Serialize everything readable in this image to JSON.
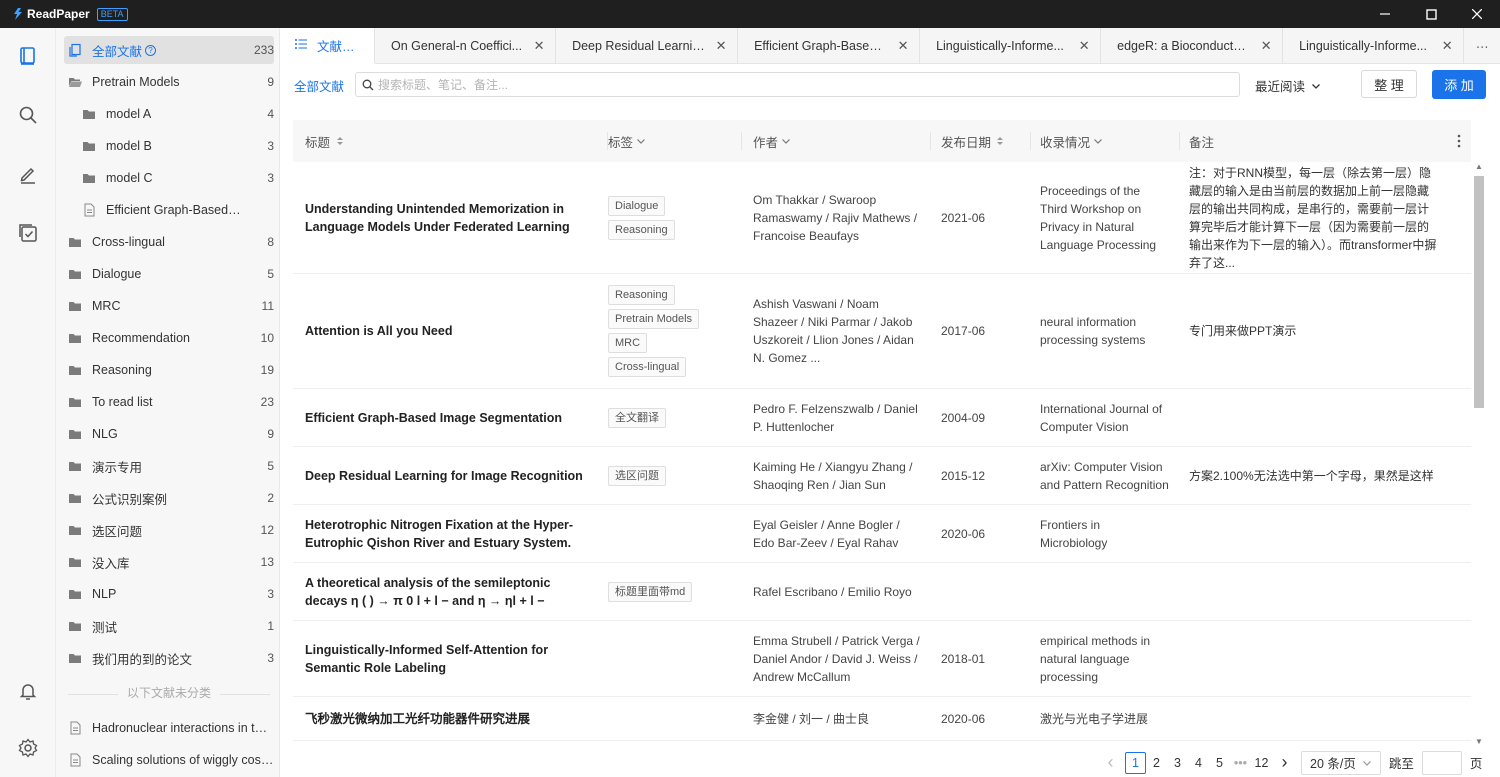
{
  "app": {
    "name": "ReadPaper",
    "badge": "BETA"
  },
  "sidebar": {
    "items": [
      {
        "label": "全部文献",
        "count": "233",
        "icon": "doc-stack-icon",
        "active": true
      },
      {
        "label": "Pretrain Models",
        "count": "9",
        "icon": "folder-open-icon"
      },
      {
        "label": "model A",
        "count": "4",
        "icon": "folder-icon"
      },
      {
        "label": "model B",
        "count": "3",
        "icon": "folder-icon"
      },
      {
        "label": "model C",
        "count": "3",
        "icon": "folder-icon"
      },
      {
        "label": "Efficient Graph-Based Image S...",
        "count": "",
        "icon": "file-icon"
      },
      {
        "label": "Cross-lingual",
        "count": "8",
        "icon": "folder-icon"
      },
      {
        "label": "Dialogue",
        "count": "5",
        "icon": "folder-icon"
      },
      {
        "label": "MRC",
        "count": "11",
        "icon": "folder-icon"
      },
      {
        "label": "Recommendation",
        "count": "10",
        "icon": "folder-icon"
      },
      {
        "label": "Reasoning",
        "count": "19",
        "icon": "folder-icon"
      },
      {
        "label": "To read list",
        "count": "23",
        "icon": "folder-icon"
      },
      {
        "label": "NLG",
        "count": "9",
        "icon": "folder-icon"
      },
      {
        "label": "演示专用",
        "count": "5",
        "icon": "folder-icon"
      },
      {
        "label": "公式识别案例",
        "count": "2",
        "icon": "folder-icon"
      },
      {
        "label": "选区问题",
        "count": "12",
        "icon": "folder-icon"
      },
      {
        "label": "没入库",
        "count": "13",
        "icon": "folder-icon"
      },
      {
        "label": "NLP",
        "count": "3",
        "icon": "folder-icon"
      },
      {
        "label": "测试",
        "count": "1",
        "icon": "folder-icon"
      },
      {
        "label": "我们用的到的论文",
        "count": "3",
        "icon": "folder-icon"
      }
    ],
    "unclassified_label": "以下文献未分类",
    "unclassified": [
      {
        "label": "Hadronuclear interactions in the j...",
        "icon": "file-icon"
      },
      {
        "label": "Scaling solutions of wiggly cosmi...",
        "icon": "file-icon"
      }
    ]
  },
  "tabs": [
    {
      "label": "文献列表",
      "active": true
    },
    {
      "label": "On General-n Coeffici..."
    },
    {
      "label": "Deep Residual Learnin..."
    },
    {
      "label": "Efficient Graph-Based I..."
    },
    {
      "label": "Linguistically-Informe..."
    },
    {
      "label": "edgeR: a Bioconductor..."
    },
    {
      "label": "Linguistically-Informe..."
    }
  ],
  "toolbar": {
    "all_label": "全部文献",
    "search_placeholder": "搜索标题、笔记、备注...",
    "sort_label": "最近阅读",
    "organize_label": "整 理",
    "add_label": "添 加"
  },
  "table": {
    "headers": {
      "title": "标题",
      "tags": "标签",
      "authors": "作者",
      "date": "发布日期",
      "venue": "收录情况",
      "notes": "备注"
    },
    "rows": [
      {
        "title": "Understanding Unintended Memorization in Language Models Under Federated Learning",
        "tags": [
          "Dialogue",
          "Reasoning"
        ],
        "authors": "Om Thakkar / Swaroop Ramaswamy / Rajiv Mathews / Francoise Beaufays",
        "date": "2021-06",
        "venue": "Proceedings of the Third Workshop on Privacy in Natural Language Processing",
        "note": "注：对于RNN模型，每一层（除去第一层）隐藏层的输入是由当前层的数据加上前一层隐藏层的输出共同构成，是串行的，需要前一层计算完毕后才能计算下一层（因为需要前一层的输出来作为下一层的输入）。而transformer中摒弃了这..."
      },
      {
        "title": "Attention is All you Need",
        "tags": [
          "Reasoning",
          "Pretrain Models",
          "MRC",
          "Cross-lingual"
        ],
        "authors": "Ashish Vaswani / Noam Shazeer / Niki Parmar / Jakob Uszkoreit / Llion Jones / Aidan N. Gomez ...",
        "date": "2017-06",
        "venue": "neural information processing systems",
        "note": "专门用来做PPT演示"
      },
      {
        "title": "Efficient Graph-Based Image Segmentation",
        "tags": [
          "全文翻译"
        ],
        "authors": "Pedro F. Felzenszwalb / Daniel P. Huttenlocher",
        "date": "2004-09",
        "venue": "International Journal of Computer Vision",
        "note": ""
      },
      {
        "title": "Deep Residual Learning for Image Recognition",
        "tags": [
          "选区问题"
        ],
        "authors": "Kaiming He / Xiangyu Zhang / Shaoqing Ren / Jian Sun",
        "date": "2015-12",
        "venue": "arXiv: Computer Vision and Pattern Recognition",
        "note": "方案2.100%无法选中第一个字母，果然是这样"
      },
      {
        "title": "Heterotrophic Nitrogen Fixation at the Hyper-Eutrophic Qishon River and Estuary System.",
        "tags": [],
        "authors": "Eyal Geisler / Anne Bogler / Edo Bar-Zeev / Eyal Rahav",
        "date": "2020-06",
        "venue": "Frontiers in Microbiology",
        "note": ""
      },
      {
        "title": "A theoretical analysis of the semileptonic decays η ( ) → π 0 l + l − and η → ηl + l −",
        "tags": [
          "标题里面带md"
        ],
        "authors": "Rafel Escribano / Emilio Royo",
        "date": "",
        "venue": "",
        "note": ""
      },
      {
        "title": "Linguistically-Informed Self-Attention for Semantic Role Labeling",
        "tags": [],
        "authors": "Emma Strubell / Patrick Verga / Daniel Andor / David J. Weiss / Andrew McCallum",
        "date": "2018-01",
        "venue": "empirical methods in natural language processing",
        "note": ""
      },
      {
        "title": "飞秒激光微纳加工光纤功能器件研究进展",
        "tags": [],
        "authors": "李金健 / 刘一 / 曲士良",
        "date": "2020-06",
        "venue": "激光与光电子学进展",
        "note": ""
      }
    ]
  },
  "pagination": {
    "pages": [
      "1",
      "2",
      "3",
      "4",
      "5",
      "•••",
      "12"
    ],
    "current": "1",
    "page_size": "20 条/页",
    "jump_label": "跳至",
    "page_unit": "页"
  },
  "colors": {
    "accent": "#1a73e8",
    "titlebar": "#1f1f1f"
  }
}
